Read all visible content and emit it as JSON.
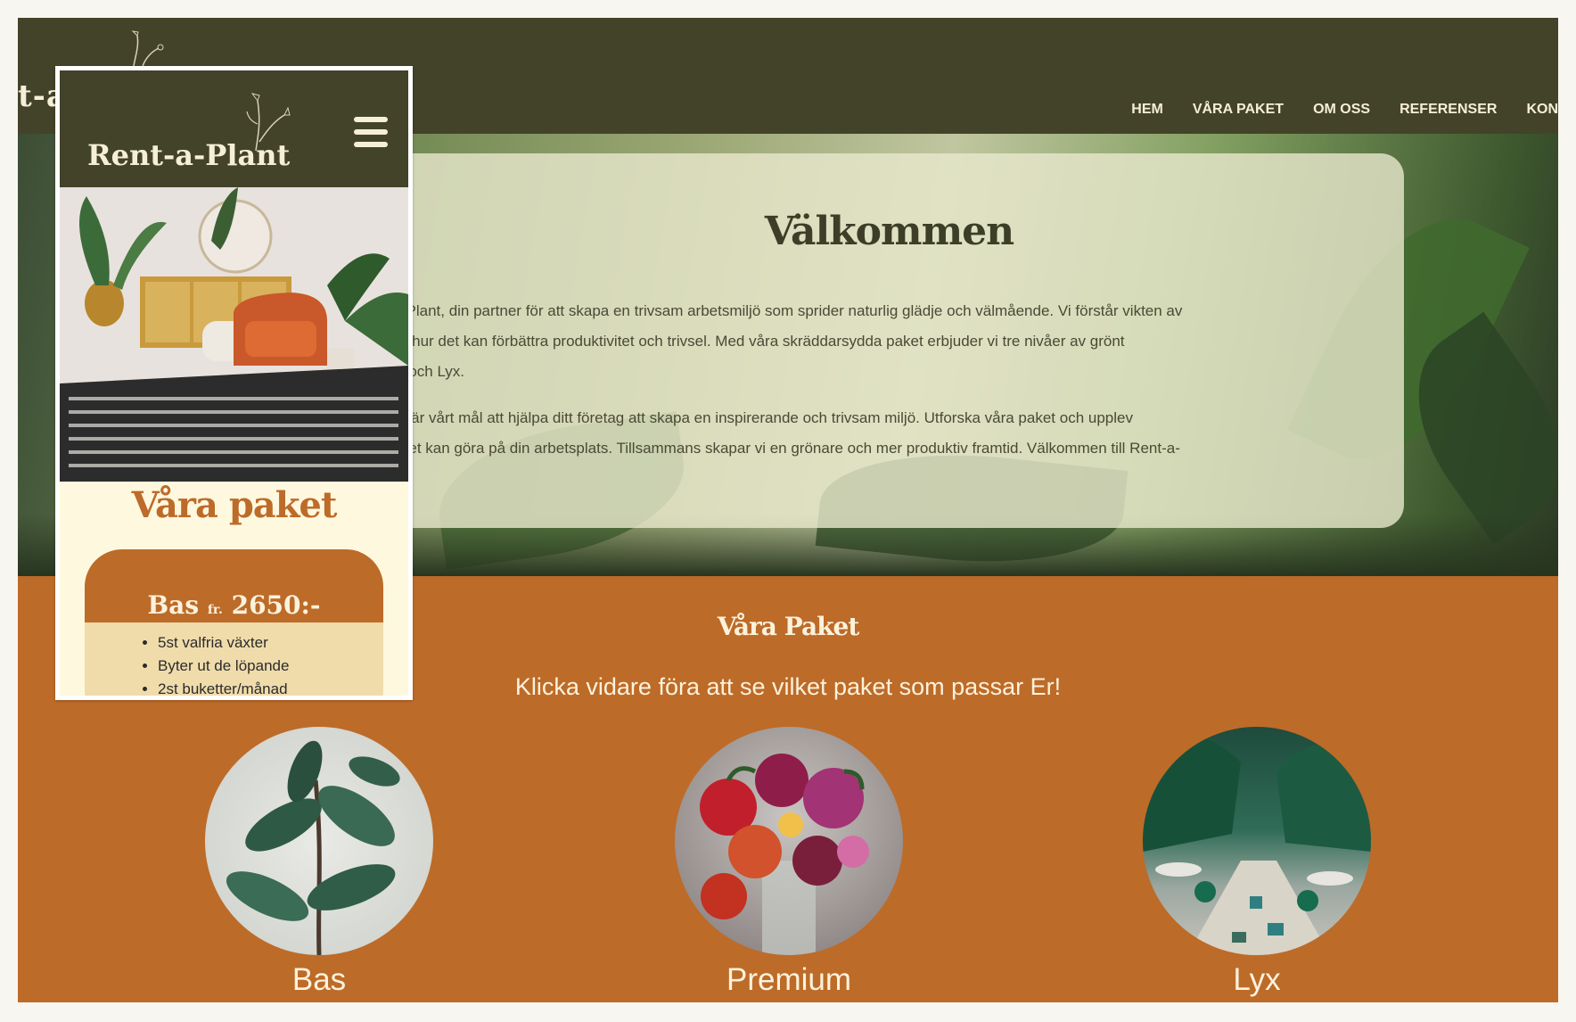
{
  "desktop": {
    "logo_partial": "t-a",
    "nav": [
      "HEM",
      "VÅRA PAKET",
      "OM OSS",
      "REFERENSER",
      "KON"
    ],
    "welcome": {
      "title": "Välkommen",
      "p1": "t-a-Plant, din partner för att skapa en trivsam arbetsmiljö som sprider naturlig glädje och välmående. Vi förstår vikten av\n och hur det kan förbättra produktivitet och trivsel. Med våra skräddarsydda paket erbjuder vi tre nivåer av grönt\num och Lyx.",
      "p2": "ljer, är vårt mål att hjälpa ditt företag att skapa en inspirerande och trivsam miljö. Utforska våra paket och upplev\nönhet kan göra på din arbetsplats. Tillsammans skapar vi en grönare och mer produktiv framtid. Välkommen till Rent-a-"
    },
    "packages": {
      "title": "Våra Paket",
      "subtitle": "Klicka vidare föra att se vilket paket som passar Er!",
      "items": [
        {
          "label": "Bas"
        },
        {
          "label": "Premium"
        },
        {
          "label": "Lyx"
        }
      ]
    }
  },
  "mobile": {
    "logo": "Rent-a-Plant",
    "menu_icon": "hamburger-icon",
    "section_title": "Våra paket",
    "card": {
      "name": "Bas",
      "price_prefix": "fr.",
      "price": "2650:-",
      "features": [
        "5st valfria växter",
        "Byter ut de löpande",
        "2st buketter/månad"
      ]
    }
  },
  "colors": {
    "header_olive": "#434329",
    "accent_orange": "#bd6b29",
    "cream": "#fef8df",
    "card_beige": "#f0dcab"
  }
}
